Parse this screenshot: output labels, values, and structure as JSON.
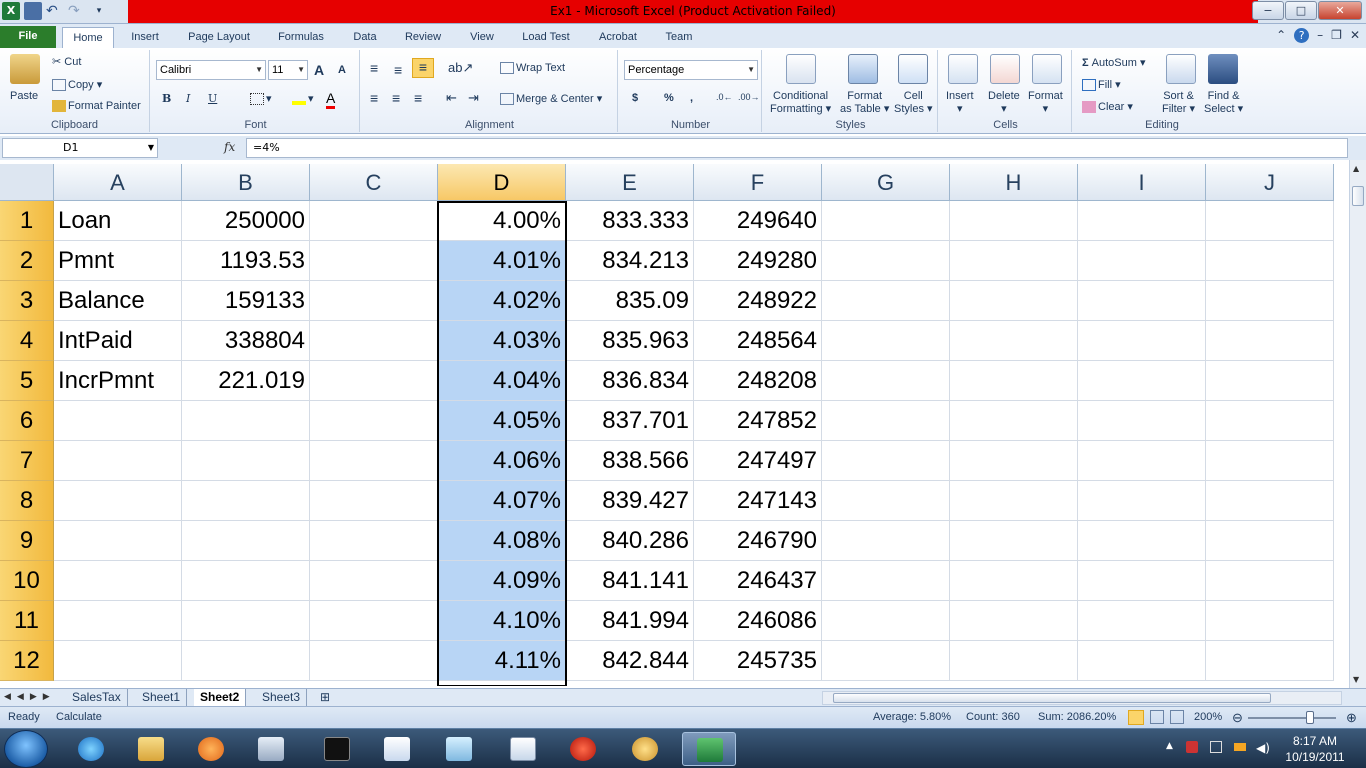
{
  "window": {
    "title": "Ex1  -  Microsoft Excel (Product Activation Failed)",
    "controls": [
      "−",
      "□",
      "✕"
    ]
  },
  "ribbon_tabs": [
    "File",
    "Home",
    "Insert",
    "Page Layout",
    "Formulas",
    "Data",
    "Review",
    "View",
    "Load Test",
    "Acrobat",
    "Team"
  ],
  "active_tab": "Home",
  "ribbon": {
    "clipboard": {
      "paste": "Paste",
      "cut": "Cut",
      "copy": "Copy",
      "format_painter": "Format Painter",
      "label": "Clipboard"
    },
    "font": {
      "name": "Calibri",
      "size": "11",
      "bold": "B",
      "italic": "I",
      "underline": "U",
      "grow": "A",
      "shrink": "A",
      "label": "Font"
    },
    "alignment": {
      "wrap_text": "Wrap Text",
      "merge_center": "Merge & Center",
      "label": "Alignment"
    },
    "number": {
      "format": "Percentage",
      "currency": "$",
      "percent": "%",
      "comma": ",",
      "label": "Number"
    },
    "styles": {
      "conditional": "Conditional",
      "formatting": "Formatting",
      "format": "Format",
      "as_table": "as Table",
      "cell": "Cell",
      "cell_styles": "Styles",
      "label": "Styles"
    },
    "cells": {
      "insert": "Insert",
      "delete": "Delete",
      "format": "Format",
      "label": "Cells"
    },
    "editing": {
      "autosum": "AutoSum",
      "fill": "Fill",
      "clear": "Clear",
      "sort": "Sort &",
      "filter": "Filter",
      "find": "Find &",
      "select": "Select",
      "label": "Editing"
    }
  },
  "formula_bar": {
    "name_box": "D1",
    "fx": "fx",
    "formula": "=4%"
  },
  "columns": [
    "A",
    "B",
    "C",
    "D",
    "E",
    "F",
    "G",
    "H",
    "I",
    "J"
  ],
  "rows": [
    {
      "num": "1",
      "A": "Loan",
      "B": "250000",
      "D": "4.00%",
      "E": "833.333",
      "F": "249640"
    },
    {
      "num": "2",
      "A": "Pmnt",
      "B": "1193.53",
      "D": "4.01%",
      "E": "834.213",
      "F": "249280"
    },
    {
      "num": "3",
      "A": "Balance",
      "B": "159133",
      "D": "4.02%",
      "E": "835.09",
      "F": "248922"
    },
    {
      "num": "4",
      "A": "IntPaid",
      "B": "338804",
      "D": "4.03%",
      "E": "835.963",
      "F": "248564"
    },
    {
      "num": "5",
      "A": "IncrPmnt",
      "B": "221.019",
      "D": "4.04%",
      "E": "836.834",
      "F": "248208"
    },
    {
      "num": "6",
      "A": "",
      "B": "",
      "D": "4.05%",
      "E": "837.701",
      "F": "247852"
    },
    {
      "num": "7",
      "A": "",
      "B": "",
      "D": "4.06%",
      "E": "838.566",
      "F": "247497"
    },
    {
      "num": "8",
      "A": "",
      "B": "",
      "D": "4.07%",
      "E": "839.427",
      "F": "247143"
    },
    {
      "num": "9",
      "A": "",
      "B": "",
      "D": "4.08%",
      "E": "840.286",
      "F": "246790"
    },
    {
      "num": "10",
      "A": "",
      "B": "",
      "D": "4.09%",
      "E": "841.141",
      "F": "246437"
    },
    {
      "num": "11",
      "A": "",
      "B": "",
      "D": "4.10%",
      "E": "841.994",
      "F": "246086"
    },
    {
      "num": "12",
      "A": "",
      "B": "",
      "D": "4.11%",
      "E": "842.844",
      "F": "245735"
    }
  ],
  "sheets": [
    "SalesTax",
    "Sheet1",
    "Sheet2",
    "Sheet3"
  ],
  "active_sheet": "Sheet2",
  "status": {
    "ready": "Ready",
    "calculate": "Calculate",
    "average": "Average: 5.80%",
    "count": "Count: 360",
    "sum": "Sum: 2086.20%",
    "zoom": "200%"
  },
  "taskbar": {
    "time": "8:17 AM",
    "date": "10/19/2011"
  },
  "colors": {
    "title_red": "#e60000",
    "file_tab": "#2b7d2b",
    "selection": "#b8d5f5",
    "row_header": "#f2b93d"
  }
}
